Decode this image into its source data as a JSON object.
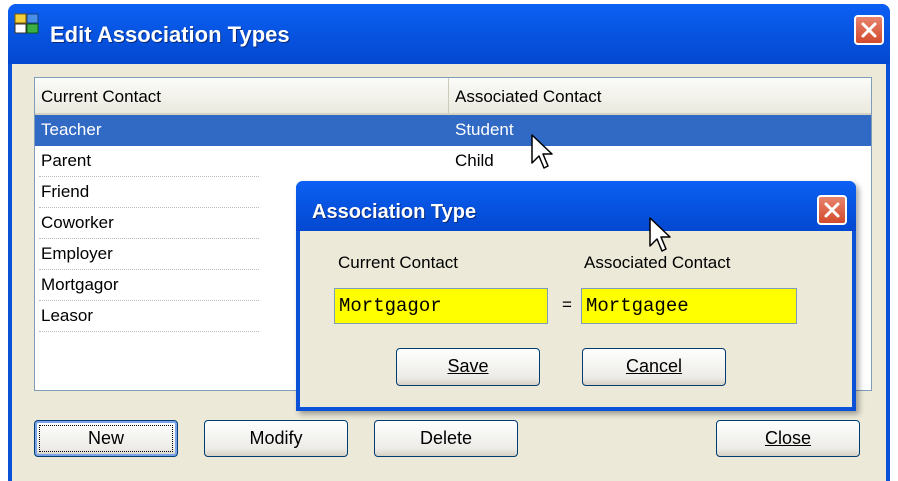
{
  "main_window": {
    "title": "Edit Association Types",
    "columns": [
      "Current Contact",
      "Associated Contact"
    ],
    "rows": [
      {
        "current": "Teacher",
        "associated": "Student",
        "selected": true
      },
      {
        "current": "Parent",
        "associated": "Child",
        "selected": false
      },
      {
        "current": "Friend",
        "associated": "",
        "selected": false
      },
      {
        "current": "Coworker",
        "associated": "",
        "selected": false
      },
      {
        "current": "Employer",
        "associated": "",
        "selected": false
      },
      {
        "current": "Mortgagor",
        "associated": "",
        "selected": false
      },
      {
        "current": "Leasor",
        "associated": "",
        "selected": false
      }
    ],
    "buttons": {
      "new": "New",
      "modify": "Modify",
      "delete": "Delete",
      "close": "Close"
    }
  },
  "dialog": {
    "title": "Association Type",
    "current_label": "Current Contact",
    "associated_label": "Associated Contact",
    "current_value": "Mortgagor",
    "equals": "=",
    "associated_value": "Mortgagee",
    "save": "Save",
    "cancel": "Cancel"
  },
  "icons": {
    "app": "application-icon",
    "close": "close-icon",
    "cursor": "mouse-pointer-icon"
  },
  "colors": {
    "titlebar": "#0a51d8",
    "selection": "#316ac5",
    "field_background": "#ffff00",
    "close_button": "#d24a2c",
    "window_face": "#ece9d8"
  }
}
